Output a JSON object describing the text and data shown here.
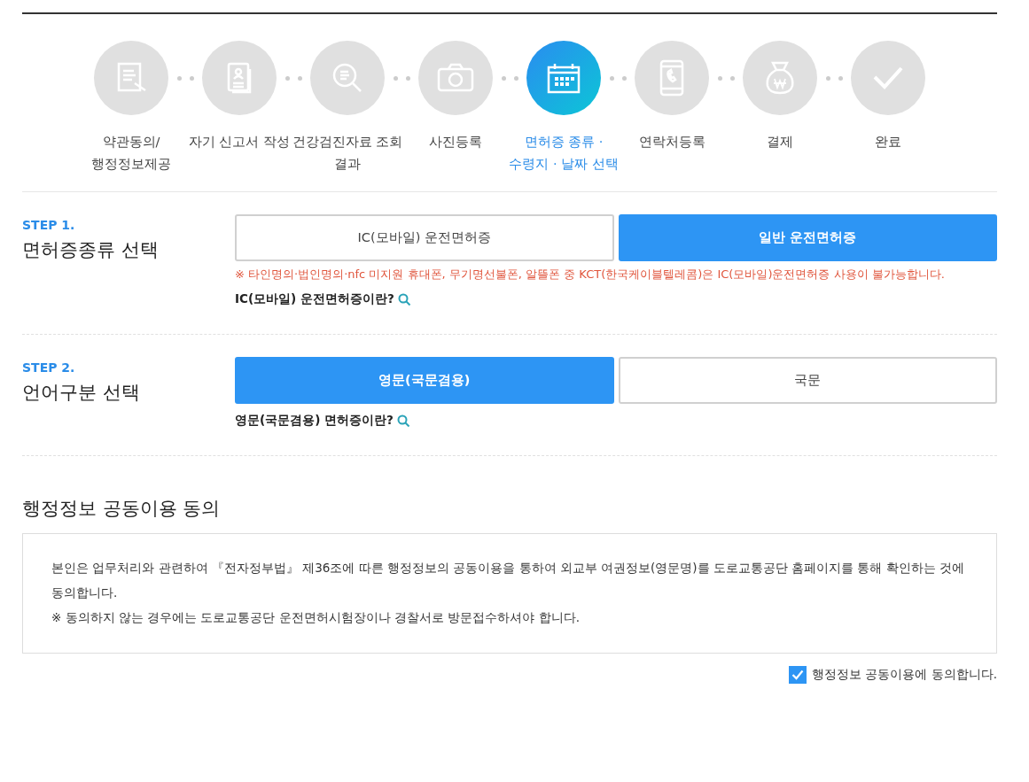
{
  "steps": [
    {
      "label_lines": [
        "약관동의/",
        "행정정보제공"
      ],
      "selected": false
    },
    {
      "label_lines": [
        "자기 신고서 작성"
      ],
      "selected": false
    },
    {
      "label_lines": [
        "건강검진자료 조회",
        "결과"
      ],
      "selected": false
    },
    {
      "label_lines": [
        "사진등록"
      ],
      "selected": false
    },
    {
      "label_lines": [
        "면허증 종류 ·",
        "수령지 · 날짜 선택"
      ],
      "selected": true
    },
    {
      "label_lines": [
        "연락처등록"
      ],
      "selected": false
    },
    {
      "label_lines": [
        "결제"
      ],
      "selected": false
    },
    {
      "label_lines": [
        "완료"
      ],
      "selected": false
    }
  ],
  "sections": [
    {
      "step": "STEP 1.",
      "title": "면허증종류 선택",
      "options": [
        {
          "label": "IC(모바일) 운전면허증",
          "selected": false
        },
        {
          "label": "일반 운전면허증",
          "selected": true
        }
      ],
      "notice": "※ 타인명의·법인명의·nfc 미지원 휴대폰, 무기명선불폰, 알뜰폰 중 KCT(한국케이블텔레콤)은 IC(모바일)운전면허증 사용이 불가능합니다.",
      "info_link": "IC(모바일) 운전면허증이란?"
    },
    {
      "step": "STEP 2.",
      "title": "언어구분 선택",
      "options": [
        {
          "label": "영문(국문겸용)",
          "selected": true
        },
        {
          "label": "국문",
          "selected": false
        }
      ],
      "info_link": "영문(국문겸용) 면허증이란?"
    }
  ],
  "consent": {
    "title": "행정정보 공동이용 동의",
    "paragraphs": [
      "본인은 업무처리와 관련하여 『전자정부법』 제36조에 따른 행정정보의 공동이용을 통하여 외교부 여권정보(영문명)를 도로교통공단 홈페이지를 통해 확인하는 것에 동의합니다.",
      "※ 동의하지 않는 경우에는 도로교통공단 운전면허시험장이나 경찰서로 방문접수하셔야 합니다."
    ],
    "checkbox": {
      "label": "행정정보 공동이용에 동의합니다.",
      "checked": true
    }
  }
}
